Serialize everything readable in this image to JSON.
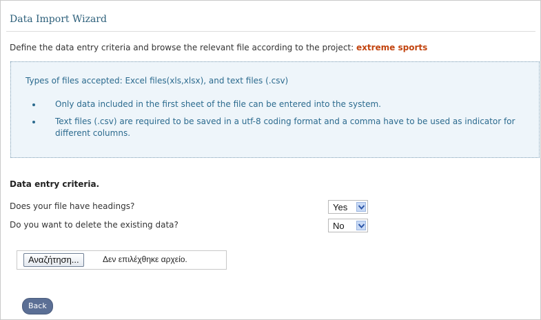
{
  "title": "Data Import Wizard",
  "intro": {
    "text": "Define the data entry criteria and browse the relevant file according to the project: ",
    "project": "extreme sports"
  },
  "info": {
    "accepted": "Types of files accepted: Excel files(xls,xlsx), and text files (.csv)",
    "bullets": [
      "Only data included in the first sheet of the file can be entered into the system.",
      "Text files (.csv) are required to be saved in a utf-8 coding format and a comma have to be used as indicator for different columns."
    ]
  },
  "criteria": {
    "title": "Data entry criteria.",
    "headings_question": "Does your file have headings?",
    "headings_value": "Yes",
    "delete_question": "Do you want to delete the existing data?",
    "delete_value": "No"
  },
  "file": {
    "browse_label": "Αναζήτηση...",
    "no_file_text": "Δεν επιλέχθηκε αρχείο."
  },
  "back_label": "Back",
  "colors": {
    "title": "#2c5f7a",
    "project": "#c2440f",
    "info_bg": "#eef5fa",
    "info_text": "#2b6a8e",
    "back_button": "#5b6f95"
  }
}
